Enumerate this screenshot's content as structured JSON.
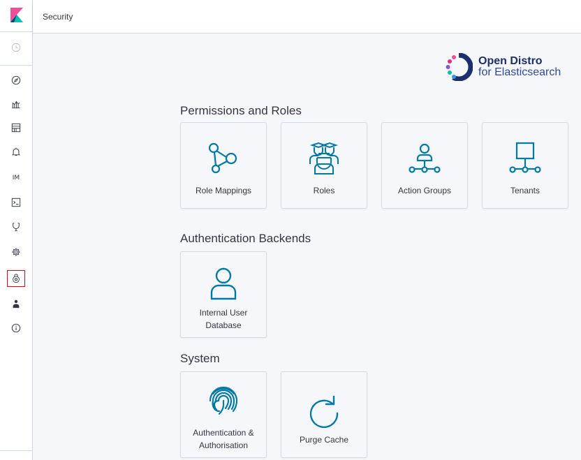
{
  "header": {
    "breadcrumb": "Security"
  },
  "brand": {
    "line1": "Open Distro",
    "line2": "for Elasticsearch"
  },
  "sidebar": {
    "items": [
      {
        "name": "recently-viewed",
        "icon": "clock-icon"
      },
      {
        "name": "discover",
        "icon": "compass-icon"
      },
      {
        "name": "visualize",
        "icon": "chart-icon"
      },
      {
        "name": "dashboard",
        "icon": "dashboard-icon"
      },
      {
        "name": "alerting",
        "icon": "bell-icon"
      },
      {
        "name": "index-management",
        "icon": "im-icon",
        "text": "IM"
      },
      {
        "name": "dev-tools",
        "icon": "console-icon"
      },
      {
        "name": "monitoring",
        "icon": "heartbeat-icon"
      },
      {
        "name": "management",
        "icon": "gear-icon"
      },
      {
        "name": "security",
        "icon": "security-icon",
        "active": true
      },
      {
        "name": "user",
        "icon": "user-icon"
      },
      {
        "name": "help",
        "icon": "info-icon"
      }
    ]
  },
  "sections": {
    "permissions": {
      "title": "Permissions and Roles",
      "cards": [
        {
          "label": "Role Mappings",
          "icon": "role-mappings-icon"
        },
        {
          "label": "Roles",
          "icon": "roles-icon"
        },
        {
          "label": "Action Groups",
          "icon": "action-groups-icon"
        },
        {
          "label": "Tenants",
          "icon": "tenants-icon"
        }
      ]
    },
    "authentication": {
      "title": "Authentication Backends",
      "cards": [
        {
          "label_line1": "Internal User",
          "label_line2": "Database",
          "icon": "user-outline-icon"
        }
      ]
    },
    "system": {
      "title": "System",
      "cards": [
        {
          "label_line1": "Authentication &",
          "label_line2": "Authorisation",
          "icon": "fingerprint-icon"
        },
        {
          "label": "Purge Cache",
          "icon": "refresh-icon"
        }
      ]
    }
  },
  "colors": {
    "accent": "#0079a5",
    "active_outline": "#e2001a",
    "logo_pink": "#f04e98",
    "logo_teal": "#00bfb3",
    "logo_navy": "#1c2e6b"
  }
}
